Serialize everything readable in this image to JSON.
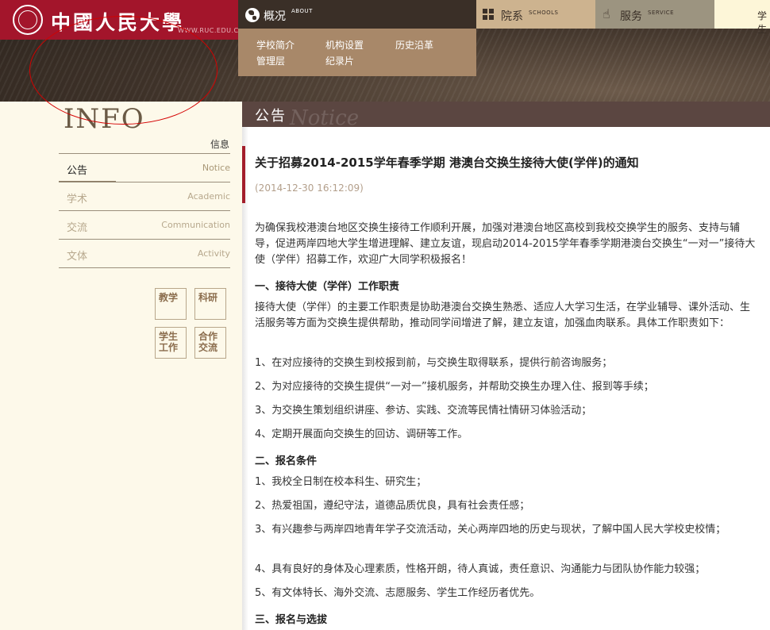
{
  "header": {
    "logo_text": "中國人民大學",
    "logo_url": "WWW.RUC.EDU.CN",
    "nav": {
      "about": {
        "label": "概况",
        "sub": "ABOUT",
        "links": [
          "学校简介",
          "机构设置",
          "历史沿革",
          "管理层",
          "纪录片"
        ]
      },
      "schools": {
        "label": "院系",
        "sub": "SCHOOLS"
      },
      "service": {
        "label": "服务",
        "sub": "SERVICE"
      },
      "student": {
        "label": "学生"
      }
    }
  },
  "sidebar": {
    "title": "INFO",
    "subtitle": "信息",
    "items": [
      {
        "cn": "公告",
        "en": "Notice"
      },
      {
        "cn": "学术",
        "en": "Academic"
      },
      {
        "cn": "交流",
        "en": "Communication"
      },
      {
        "cn": "文体",
        "en": "Activity"
      }
    ],
    "quick_links": [
      {
        "line1": "教学",
        "line2": ""
      },
      {
        "line1": "科研",
        "line2": ""
      },
      {
        "line1": "学生",
        "line2": "工作"
      },
      {
        "line1": "合作",
        "line2": "交流"
      }
    ]
  },
  "main": {
    "section_title": "公告",
    "section_watermark": "Notice",
    "article": {
      "title": "关于招募2014-2015学年春季学期 港澳台交换生接待大使(学伴)的通知",
      "date": "(2014-12-30 16:12:09)",
      "intro": "为确保我校港澳台地区交换生接待工作顺利开展，加强对港澳台地区高校到我校交换学生的服务、支持与辅导，促进两岸四地大学生增进理解、建立友谊，现启动2014-2015学年春季学期港澳台交换生“一对一”接待大使（学伴）招募工作，欢迎广大同学积极报名！",
      "h1": "一、接待大使（学伴）工作职责",
      "duties_intro": "接待大使（学伴）的主要工作职责是协助港澳台交换生熟悉、适应人大学习生活，在学业辅导、课外活动、生活服务等方面为交换生提供帮助，推动同学间增进了解，建立友谊，加强血肉联系。具体工作职责如下：",
      "duties": [
        "1、在对应接待的交换生到校报到前，与交换生取得联系，提供行前咨询服务；",
        "2、为对应接待的交换生提供“一对一”接机服务，并帮助交换生办理入住、报到等手续；",
        "3、为交换生策划组织讲座、参访、实践、交流等民情社情研习体验活动；",
        "4、定期开展面向交换生的回访、调研等工作。"
      ],
      "h2": "二、报名条件",
      "requirements": [
        "1、我校全日制在校本科生、研究生；",
        "2、热爱祖国，遵纪守法，道德品质优良，具有社会责任感；",
        "3、有兴趣参与两岸四地青年学子交流活动，关心两岸四地的历史与现状，了解中国人民大学校史校情；",
        "4、具有良好的身体及心理素质，性格开朗，待人真诚，责任意识、沟通能力与团队协作能力较强；",
        "5、有文体特长、海外交流、志愿服务、学生工作经历者优先。"
      ],
      "h3": "三、报名与选拔"
    }
  }
}
